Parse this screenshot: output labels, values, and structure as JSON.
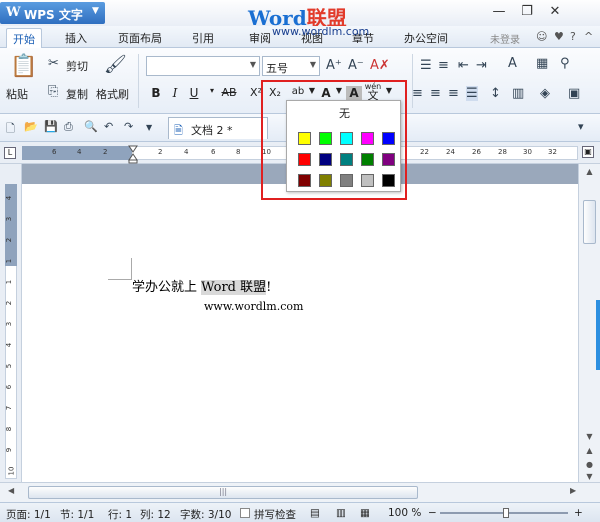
{
  "titlebar": {
    "app_logo": "W",
    "app_name": "WPS 文字",
    "watermark_logo_a": "Word",
    "watermark_logo_b": "联盟",
    "watermark_url": "www.wordlm.com"
  },
  "menu": {
    "tabs": [
      "开始",
      "插入",
      "页面布局",
      "引用",
      "审阅",
      "视图",
      "章节",
      "办公空间"
    ],
    "active_tab": "开始",
    "login": "未登录"
  },
  "ribbon": {
    "paste": "粘贴",
    "cut": "剪切",
    "copy": "复制",
    "format_painter": "格式刷",
    "font_name": "",
    "font_size": "五号",
    "bold": "B",
    "italic": "I",
    "underline": "U",
    "superscript": "X²",
    "subscript": "X₂",
    "phonetic": "wén",
    "phonetic_char": "文"
  },
  "highlight_dropdown": {
    "none_label": "无",
    "swatches": [
      "#ffff00",
      "#00ff00",
      "#00ffff",
      "#ff00ff",
      "#0000ff",
      "#ff0000",
      "#000080",
      "#008080",
      "#008000",
      "#800080",
      "#800000",
      "#808000",
      "#808080",
      "#c0c0c0",
      "#000000"
    ]
  },
  "quickbar": {
    "doc_tab": "文档 2 *"
  },
  "ruler": {
    "numbers": [
      "6",
      "4",
      "2",
      "2",
      "4",
      "6",
      "8",
      "10",
      "22",
      "24",
      "26",
      "28",
      "30",
      "32",
      "34",
      "36",
      "38"
    ]
  },
  "vruler": {
    "numbers": [
      "4",
      "3",
      "2",
      "1",
      "1",
      "2",
      "3",
      "4",
      "5",
      "6",
      "7",
      "8",
      "9",
      "10"
    ]
  },
  "document": {
    "line1_prefix": "学办公就上",
    "line1_highlight": "Word 联盟",
    "line1_suffix": "!",
    "line2": "www.wordlm.com"
  },
  "status": {
    "page": "页面: 1/1",
    "section": "节: 1/1",
    "row": "行: 1",
    "col": "列: 12",
    "words": "字数: 3/10",
    "spellcheck": "拼写检查",
    "zoom": "100 %"
  }
}
